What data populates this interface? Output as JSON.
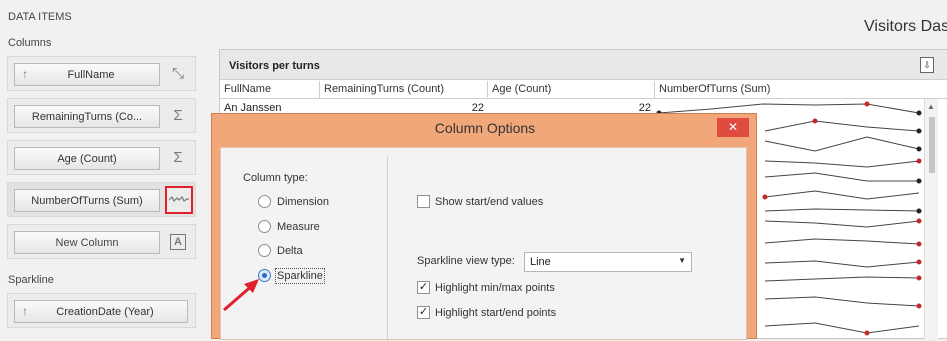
{
  "left_panel": {
    "data_items_label": "DATA ITEMS",
    "columns_label": "Columns",
    "sparkline_label": "Sparkline",
    "column_fields": [
      {
        "label": "FullName",
        "icon": "sort-ascending-icon"
      },
      {
        "label": "RemainingTurns (Co...",
        "icon": "sigma-icon"
      },
      {
        "label": "Age (Count)",
        "icon": "sigma-icon"
      },
      {
        "label": "NumberOfTurns (Sum)",
        "icon": "sparkline-icon"
      }
    ],
    "new_column_label": "New Column",
    "sparkline_fields": [
      {
        "label": "CreationDate (Year)"
      }
    ]
  },
  "dashboard": {
    "title": "Visitors Das"
  },
  "grid": {
    "title": "Visitors per turns",
    "columns": [
      "FullName",
      "RemainingTurns (Count)",
      "Age (Count)",
      "NumberOfTurns (Sum)"
    ],
    "rows": [
      {
        "FullName": "An Janssen",
        "RemainingTurns": "22",
        "Age": "22"
      }
    ]
  },
  "dialog": {
    "title": "Column Options",
    "close_symbol": "✕",
    "column_type_label": "Column type:",
    "column_types": [
      "Dimension",
      "Measure",
      "Delta",
      "Sparkline"
    ],
    "selected_type": "Sparkline",
    "show_start_end_values": {
      "label": "Show start/end values",
      "checked": false
    },
    "sparkline_view_type": {
      "label": "Sparkline view type:",
      "value": "Line"
    },
    "highlight_min_max": {
      "label": "Highlight min/max points",
      "checked": true
    },
    "highlight_start_end": {
      "label": "Highlight start/end points",
      "checked": true
    }
  },
  "colors": {
    "dialog_frame": "#f2a77a",
    "close_button": "#e04b3f",
    "highlight_border": "#e0202a",
    "arrow": "#e0202a",
    "sparkline_point": "#c62828",
    "sparkline_end_point": "#222222"
  }
}
